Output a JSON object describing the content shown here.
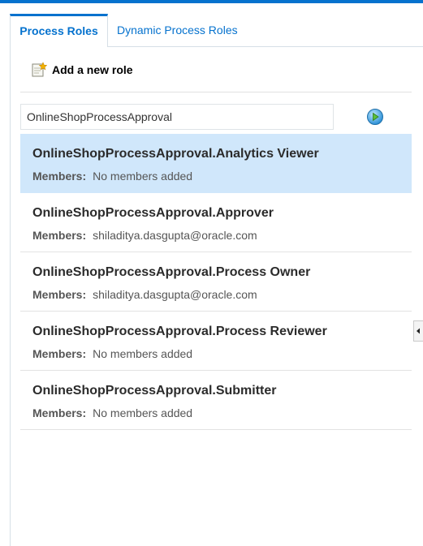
{
  "tabs": [
    {
      "label": "Process Roles",
      "active": true
    },
    {
      "label": "Dynamic Process Roles",
      "active": false
    }
  ],
  "toolbar": {
    "add_role_label": "Add a new role",
    "add_role_icon": "add-document-icon"
  },
  "search": {
    "value": "OnlineShopProcessApproval",
    "go_icon": "go-arrow-icon"
  },
  "roles": [
    {
      "name": "OnlineShopProcessApproval.Analytics Viewer",
      "members_label": "Members:",
      "members": "No members added",
      "selected": true
    },
    {
      "name": "OnlineShopProcessApproval.Approver",
      "members_label": "Members:",
      "members": "shiladitya.dasgupta@oracle.com",
      "selected": false
    },
    {
      "name": "OnlineShopProcessApproval.Process Owner",
      "members_label": "Members:",
      "members": "shiladitya.dasgupta@oracle.com",
      "selected": false
    },
    {
      "name": "OnlineShopProcessApproval.Process Reviewer",
      "members_label": "Members:",
      "members": "No members added",
      "selected": false
    },
    {
      "name": "OnlineShopProcessApproval.Submitter",
      "members_label": "Members:",
      "members": "No members added",
      "selected": false
    }
  ],
  "colors": {
    "accent": "#0572ce",
    "selected_row": "#d0e7fb"
  }
}
